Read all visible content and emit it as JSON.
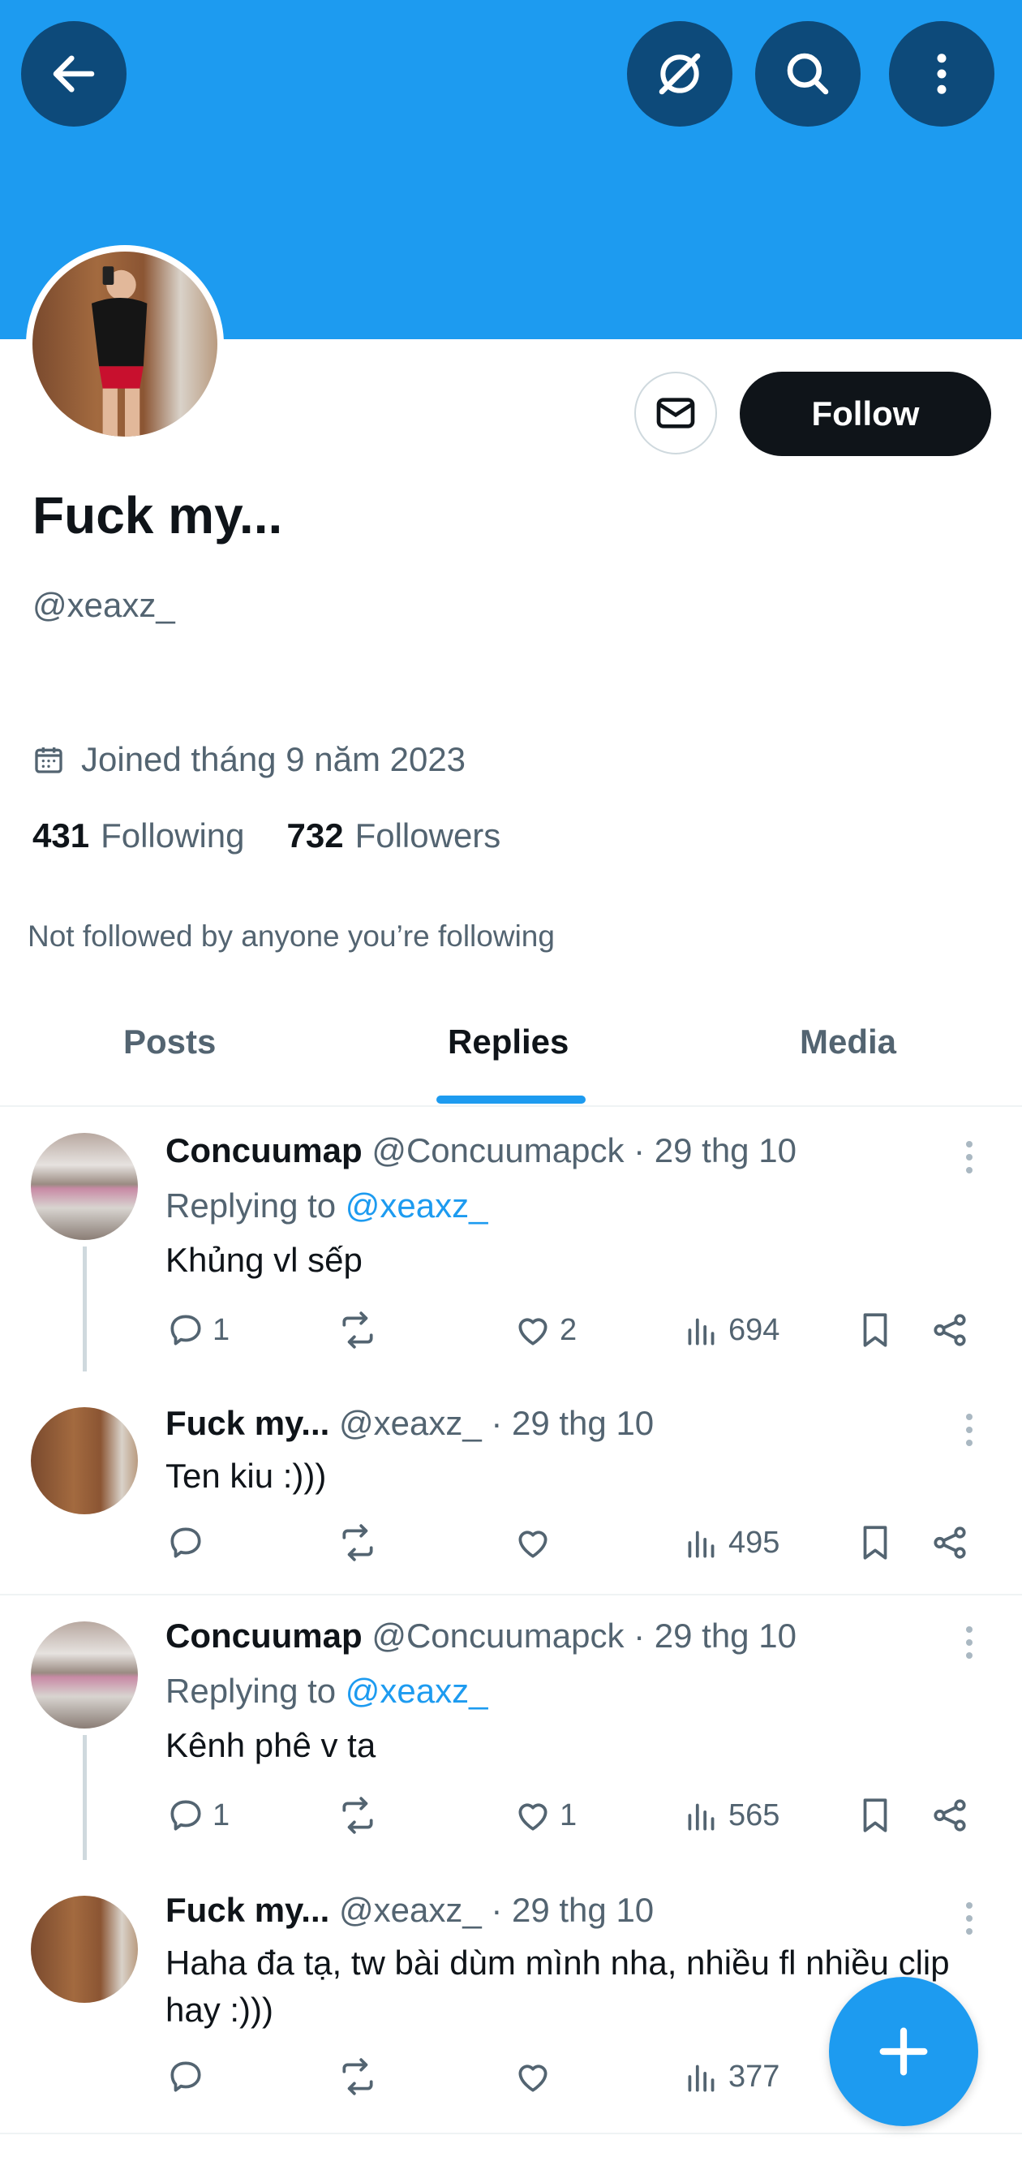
{
  "header": {
    "back_icon": "arrow-left-icon",
    "grok_icon": "grok-icon",
    "search_icon": "search-icon",
    "more_icon": "more-vertical-icon",
    "banner_color": "#1d9bf0"
  },
  "profile": {
    "name": "Fuck my...",
    "handle": "@xeaxz_",
    "joined": "Joined tháng 9 năm 2023",
    "following_count": "431",
    "following_label": "Following",
    "followers_count": "732",
    "followers_label": "Followers",
    "not_followed": "Not followed by anyone you’re following",
    "follow_label": "Follow",
    "message_icon": "mail-icon"
  },
  "tabs": [
    {
      "label": "Posts",
      "active": false
    },
    {
      "label": "Replies",
      "active": true
    },
    {
      "label": "Media",
      "active": false
    }
  ],
  "posts": [
    {
      "name": "Concuumap",
      "meta": "@Concuumapck · 29 thg 10",
      "replying_prefix": "Replying to",
      "replying_to": "@xeaxz_",
      "text": "Khủng vl sếp",
      "replies": "1",
      "retweets": "",
      "likes": "2",
      "views": "694"
    },
    {
      "name": "Fuck my...",
      "meta": "@xeaxz_ · 29 thg 10",
      "text": "Ten kiu :)))",
      "replies": "",
      "retweets": "",
      "likes": "",
      "views": "495"
    },
    {
      "name": "Concuumap",
      "meta": "@Concuumapck · 29 thg 10",
      "replying_prefix": "Replying to",
      "replying_to": "@xeaxz_",
      "text": "Kênh phê v ta",
      "replies": "1",
      "retweets": "",
      "likes": "1",
      "views": "565"
    },
    {
      "name": "Fuck my...",
      "meta": "@xeaxz_ · 29 thg 10",
      "text": "Haha đa tạ, tw bài dùm mình nha, nhiều fl nhiều clip hay :)))",
      "replies": "",
      "retweets": "",
      "likes": "",
      "views": "377"
    }
  ],
  "fab_icon": "plus-icon",
  "accent_color": "#1d9bf0"
}
